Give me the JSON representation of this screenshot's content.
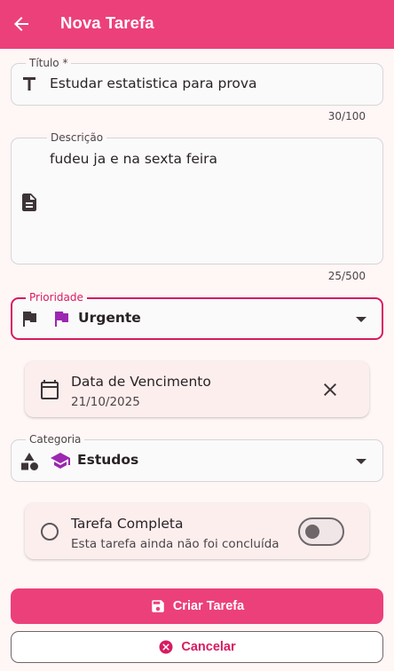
{
  "appbar": {
    "title": "Nova Tarefa"
  },
  "title_field": {
    "label": "Título *",
    "value": "Estudar estatistica para prova",
    "counter": "30/100"
  },
  "description_field": {
    "label": "Descrição",
    "value": "fudeu ja e na sexta feira",
    "counter": "25/500"
  },
  "priority_field": {
    "label": "Prioridade",
    "value": "Urgente",
    "accent_color": "#9c27b0"
  },
  "due_date": {
    "label": "Data de Vencimento",
    "value": "21/10/2025"
  },
  "category_field": {
    "label": "Categoria",
    "value": "Estudos",
    "accent_color": "#9c27b0"
  },
  "completion": {
    "label": "Tarefa Completa",
    "subtitle": "Esta tarefa ainda não foi concluída",
    "checked": false
  },
  "actions": {
    "create_label": "Criar Tarefa",
    "cancel_label": "Cancelar"
  },
  "colors": {
    "primary": "#ec407a",
    "primary_dark": "#d81b60",
    "background": "#fff6f6"
  },
  "icons": [
    "arrow-back-icon",
    "title-icon",
    "description-icon",
    "flag-icon",
    "calendar-icon",
    "close-icon",
    "category-shapes-icon",
    "school-icon",
    "radio-unchecked-icon",
    "save-icon",
    "cancel-icon"
  ]
}
